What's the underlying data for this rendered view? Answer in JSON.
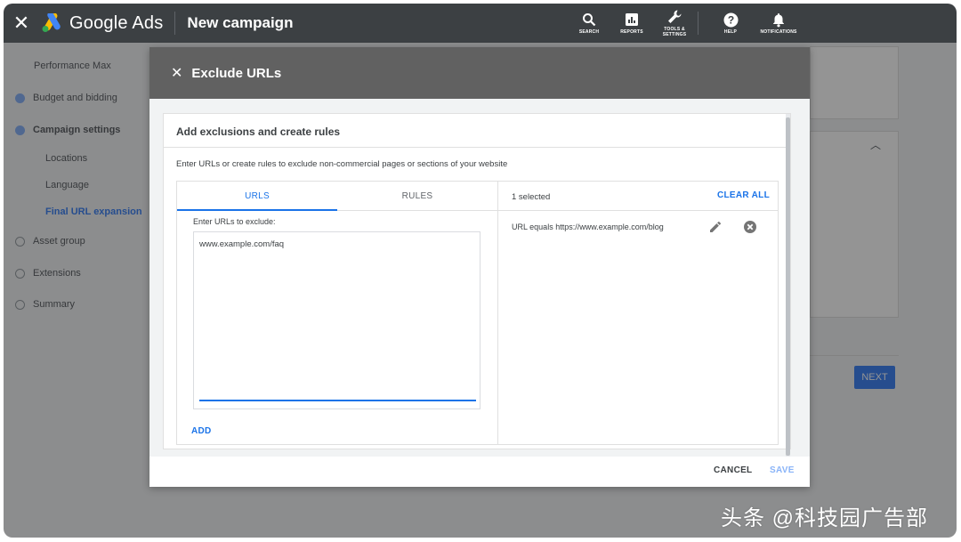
{
  "appbar": {
    "close_icon": "close-icon",
    "logo_text": "Google Ads",
    "page_title": "New campaign",
    "tools": [
      {
        "icon": "search-icon",
        "label": "SEARCH"
      },
      {
        "icon": "reports-icon",
        "label": "REPORTS"
      },
      {
        "icon": "wrench-icon",
        "label": "TOOLS &\nSETTINGS"
      },
      {
        "icon": "help-icon",
        "label": "HELP"
      },
      {
        "icon": "bell-icon",
        "label": "NOTIFICATIONS"
      }
    ]
  },
  "sidenav": {
    "items": [
      {
        "label": "Performance Max",
        "status": "none"
      },
      {
        "label": "Budget and bidding",
        "status": "done"
      },
      {
        "label": "Campaign settings",
        "status": "done"
      },
      {
        "label": "Locations",
        "status": "sub"
      },
      {
        "label": "Language",
        "status": "sub"
      },
      {
        "label": "Final URL expansion",
        "status": "sub-active"
      },
      {
        "label": "Asset group",
        "status": "open"
      },
      {
        "label": "Extensions",
        "status": "open"
      },
      {
        "label": "Summary",
        "status": "open"
      }
    ]
  },
  "background": {
    "next_label": "NEXT"
  },
  "modal": {
    "title": "Exclude URLs",
    "card_title": "Add exclusions and create rules",
    "description": "Enter URLs or create rules to exclude non-commercial pages or sections of your website",
    "tabs": [
      {
        "label": "URLS",
        "active": true
      },
      {
        "label": "RULES",
        "active": false
      }
    ],
    "urls_label": "Enter URLs to exclude:",
    "urls_value": "www.example.com/faq",
    "add_label": "ADD",
    "selected_count": "1 selected",
    "clear_all_label": "CLEAR ALL",
    "rules": [
      {
        "text": "URL equals https://www.example.com/blog"
      }
    ],
    "cancel_label": "CANCEL",
    "save_label": "SAVE"
  },
  "colors": {
    "appbar_bg": "#3c4043",
    "accent": "#1a73e8",
    "modal_header_bg": "#616161"
  },
  "watermark": "头条 @科技园广告部"
}
